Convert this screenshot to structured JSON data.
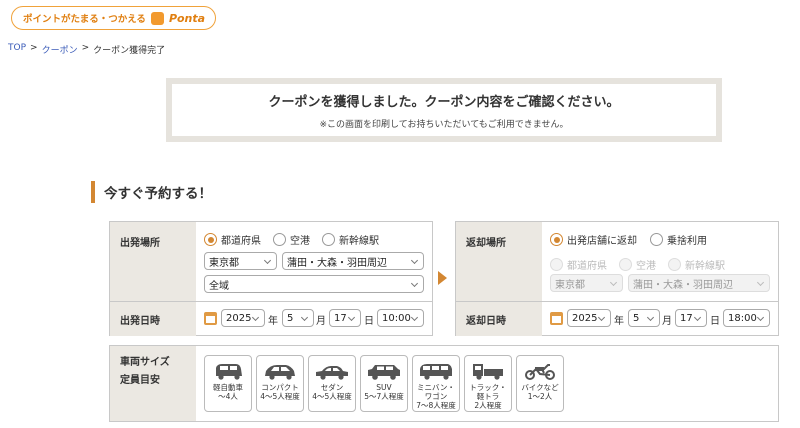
{
  "ponta": {
    "text": "ポイントがたまる・つかえる",
    "brand": "Ponta"
  },
  "breadcrumb": {
    "top": "TOP",
    "sep1": ">",
    "coupon": "クーポン",
    "sep2": ">",
    "current": "クーポン獲得完了"
  },
  "notice": {
    "title": "クーポンを獲得しました。クーポン内容をご確認ください。",
    "sub": "※この画面を印刷してお持ちいただいてもご利用できません。"
  },
  "section_title": "今すぐ予約する！",
  "departure": {
    "place_label": "出発場所",
    "radios": [
      "都道府県",
      "空港",
      "新幹線駅"
    ],
    "prefecture": "東京都",
    "area": "蒲田・大森・羽田周辺",
    "district": "全域",
    "date_label": "出発日時",
    "year": "2025",
    "year_unit": "年",
    "month": "5",
    "month_unit": "月",
    "day": "17",
    "day_unit": "日",
    "time": "10:00"
  },
  "return": {
    "place_label": "返却場所",
    "radios": [
      "出発店舗に返却",
      "乗捨利用"
    ],
    "sub_radios": [
      "都道府県",
      "空港",
      "新幹線駅"
    ],
    "prefecture": "東京都",
    "area": "蒲田・大森・羽田周辺",
    "date_label": "返却日時",
    "year": "2025",
    "year_unit": "年",
    "month": "5",
    "month_unit": "月",
    "day": "17",
    "day_unit": "日",
    "time": "18:00"
  },
  "vehicle": {
    "label1": "車両サイズ",
    "label2": "定員目安",
    "types": [
      {
        "label": "軽自動車\n〜4人",
        "icon": "kei-car-icon"
      },
      {
        "label": "コンパクト\n4〜5人程度",
        "icon": "compact-car-icon"
      },
      {
        "label": "セダン\n4〜5人程度",
        "icon": "sedan-icon"
      },
      {
        "label": "SUV\n5〜7人程度",
        "icon": "suv-icon"
      },
      {
        "label": "ミニバン・\nワゴン\n7〜8人程度",
        "icon": "minivan-icon"
      },
      {
        "label": "トラック・\n軽トラ\n2人程度",
        "icon": "truck-icon"
      },
      {
        "label": "バイクなど\n1〜2人",
        "icon": "motorcycle-icon"
      }
    ]
  },
  "colors": {
    "accent": "#d38732",
    "label_bg": "#ebe8e2",
    "link": "#3a5bb8"
  }
}
